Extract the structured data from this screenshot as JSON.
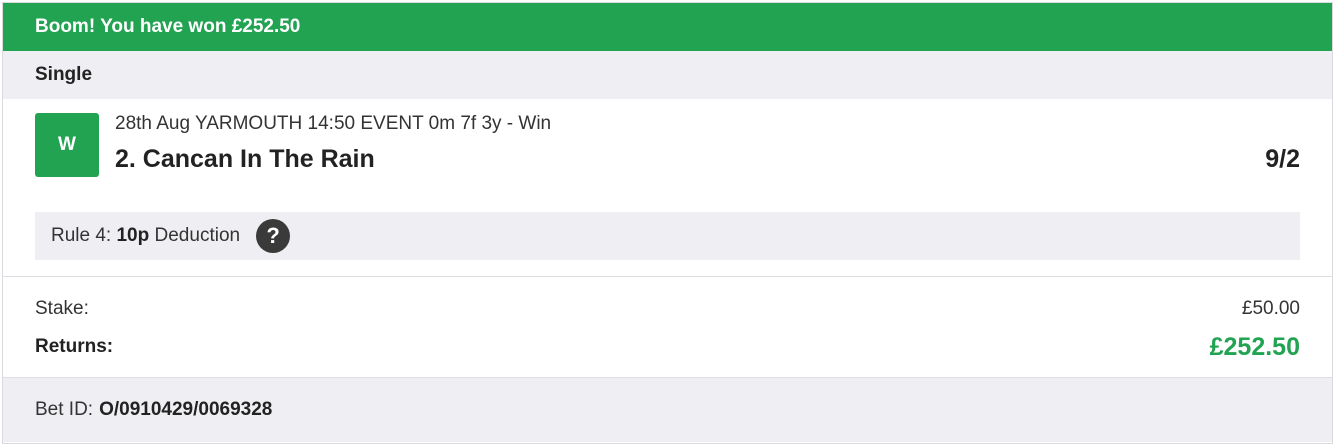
{
  "banner": {
    "text": "Boom! You have won £252.50"
  },
  "bet_type": "Single",
  "selection": {
    "result_badge": "W",
    "event": "28th Aug YARMOUTH 14:50 EVENT 0m 7f 3y - Win",
    "runner": "2. Cancan In The Rain",
    "odds": "9/2",
    "rule4": {
      "prefix": "Rule 4:",
      "amount": "10p",
      "suffix": "Deduction",
      "help_icon": "?"
    }
  },
  "totals": {
    "stake_label": "Stake:",
    "stake_value": "£50.00",
    "returns_label": "Returns:",
    "returns_value": "£252.50"
  },
  "footer": {
    "bet_id_label": "Bet ID:",
    "bet_id_value": "O/0910429/0069328"
  },
  "colors": {
    "win_green": "#22a352",
    "panel_grey": "#efeff3"
  }
}
